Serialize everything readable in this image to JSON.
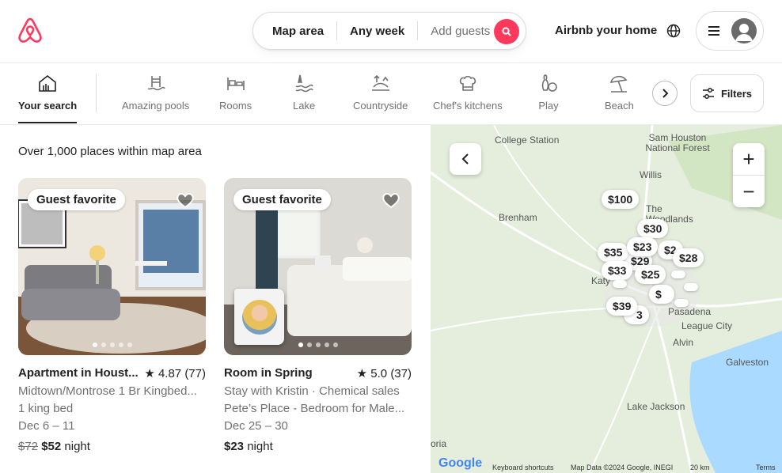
{
  "header": {
    "search": {
      "where": "Map area",
      "when": "Any week",
      "who": "Add guests"
    },
    "host_link": "Airbnb your home"
  },
  "categories": [
    {
      "label": "Your search",
      "icon": "home-search-icon"
    },
    {
      "label": "Amazing pools",
      "icon": "pool-icon"
    },
    {
      "label": "Rooms",
      "icon": "bed-icon"
    },
    {
      "label": "Lake",
      "icon": "lake-icon"
    },
    {
      "label": "Countryside",
      "icon": "countryside-icon"
    },
    {
      "label": "Chef's kitchens",
      "icon": "chef-hat-icon"
    },
    {
      "label": "Play",
      "icon": "bowling-icon"
    },
    {
      "label": "Beach",
      "icon": "umbrella-icon"
    }
  ],
  "filters_label": "Filters",
  "results_count": "Over 1,000 places within map area",
  "listings": [
    {
      "badge": "Guest favorite",
      "title": "Apartment in Houst...",
      "rating": "4.87 (77)",
      "line1": "Midtown/Montrose 1 Br Kingbed...",
      "line2": "1 king bed",
      "dates": "Dec 6 – 11",
      "old_price": "$72",
      "price": "$52",
      "unit": "night"
    },
    {
      "badge": "Guest favorite",
      "title": "Room in Spring",
      "rating": "5.0 (37)",
      "line1": "Stay with Kristin · Chemical sales",
      "line2": "Pete’s Place - Bedroom for Male...",
      "dates": "Dec 25 – 30",
      "price": "$23",
      "unit": "night"
    }
  ],
  "map": {
    "places": [
      "College Station",
      "Sam Houston National Forest",
      "Willis",
      "Brenham",
      "The Woodlands",
      "Katy",
      "Pasadena",
      "League City",
      "Alvin",
      "Galveston",
      "Lake Jackson",
      "oria"
    ],
    "pins": [
      "$100",
      "$30",
      "$23",
      "$35",
      "$2",
      "$28",
      "$29",
      "$33",
      "$25",
      "$",
      "$39",
      "3"
    ],
    "attribution": [
      "Keyboard shortcuts",
      "Map Data ©2024 Google, INEGI",
      "20 km",
      "Terms"
    ],
    "logo": "Google"
  }
}
